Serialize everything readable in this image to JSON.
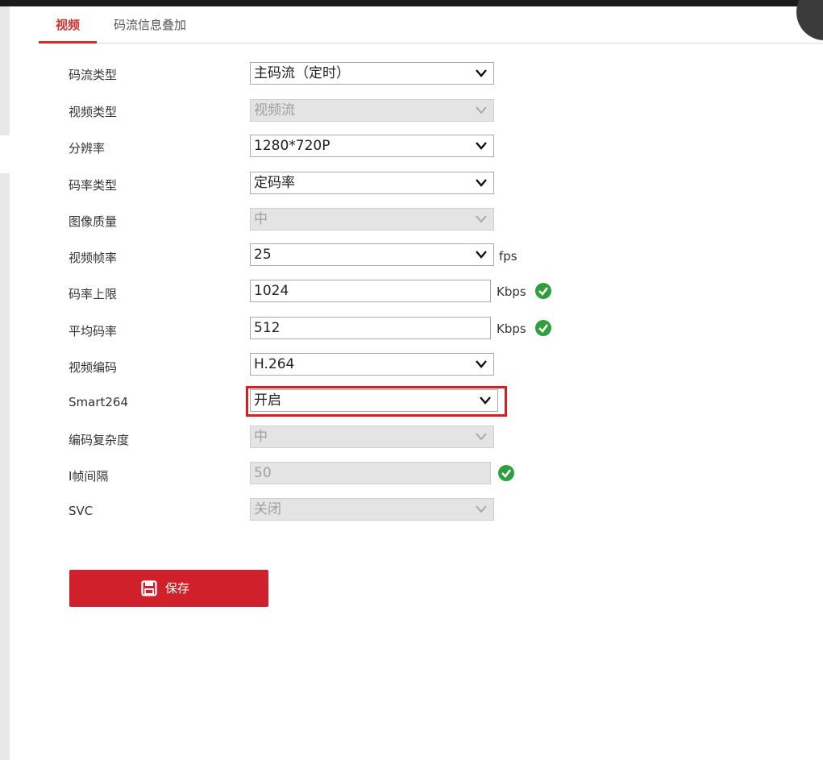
{
  "tabs": [
    {
      "label": "视频",
      "active": true
    },
    {
      "label": "码流信息叠加",
      "active": false
    }
  ],
  "form": {
    "stream_type": {
      "label": "码流类型",
      "value": "主码流（定时）"
    },
    "video_type": {
      "label": "视频类型",
      "value": "视频流"
    },
    "resolution": {
      "label": "分辨率",
      "value": "1280*720P"
    },
    "bitrate_type": {
      "label": "码率类型",
      "value": "定码率"
    },
    "image_quality": {
      "label": "图像质量",
      "value": "中"
    },
    "frame_rate": {
      "label": "视频帧率",
      "value": "25",
      "unit": "fps"
    },
    "max_bitrate": {
      "label": "码率上限",
      "value": "1024",
      "unit": "Kbps"
    },
    "avg_bitrate": {
      "label": "平均码率",
      "value": "512",
      "unit": "Kbps"
    },
    "video_encoding": {
      "label": "视频编码",
      "value": "H.264"
    },
    "smart264": {
      "label": "Smart264",
      "value": "开启"
    },
    "encoding_complexity": {
      "label": "编码复杂度",
      "value": "中"
    },
    "i_frame_interval": {
      "label": "I帧间隔",
      "value": "50"
    },
    "svc": {
      "label": "SVC",
      "value": "关闭"
    }
  },
  "save_button": {
    "label": "保存"
  },
  "colors": {
    "accent": "#d0212b",
    "highlight": "#e01b1b",
    "valid": "#2e9e3e"
  }
}
